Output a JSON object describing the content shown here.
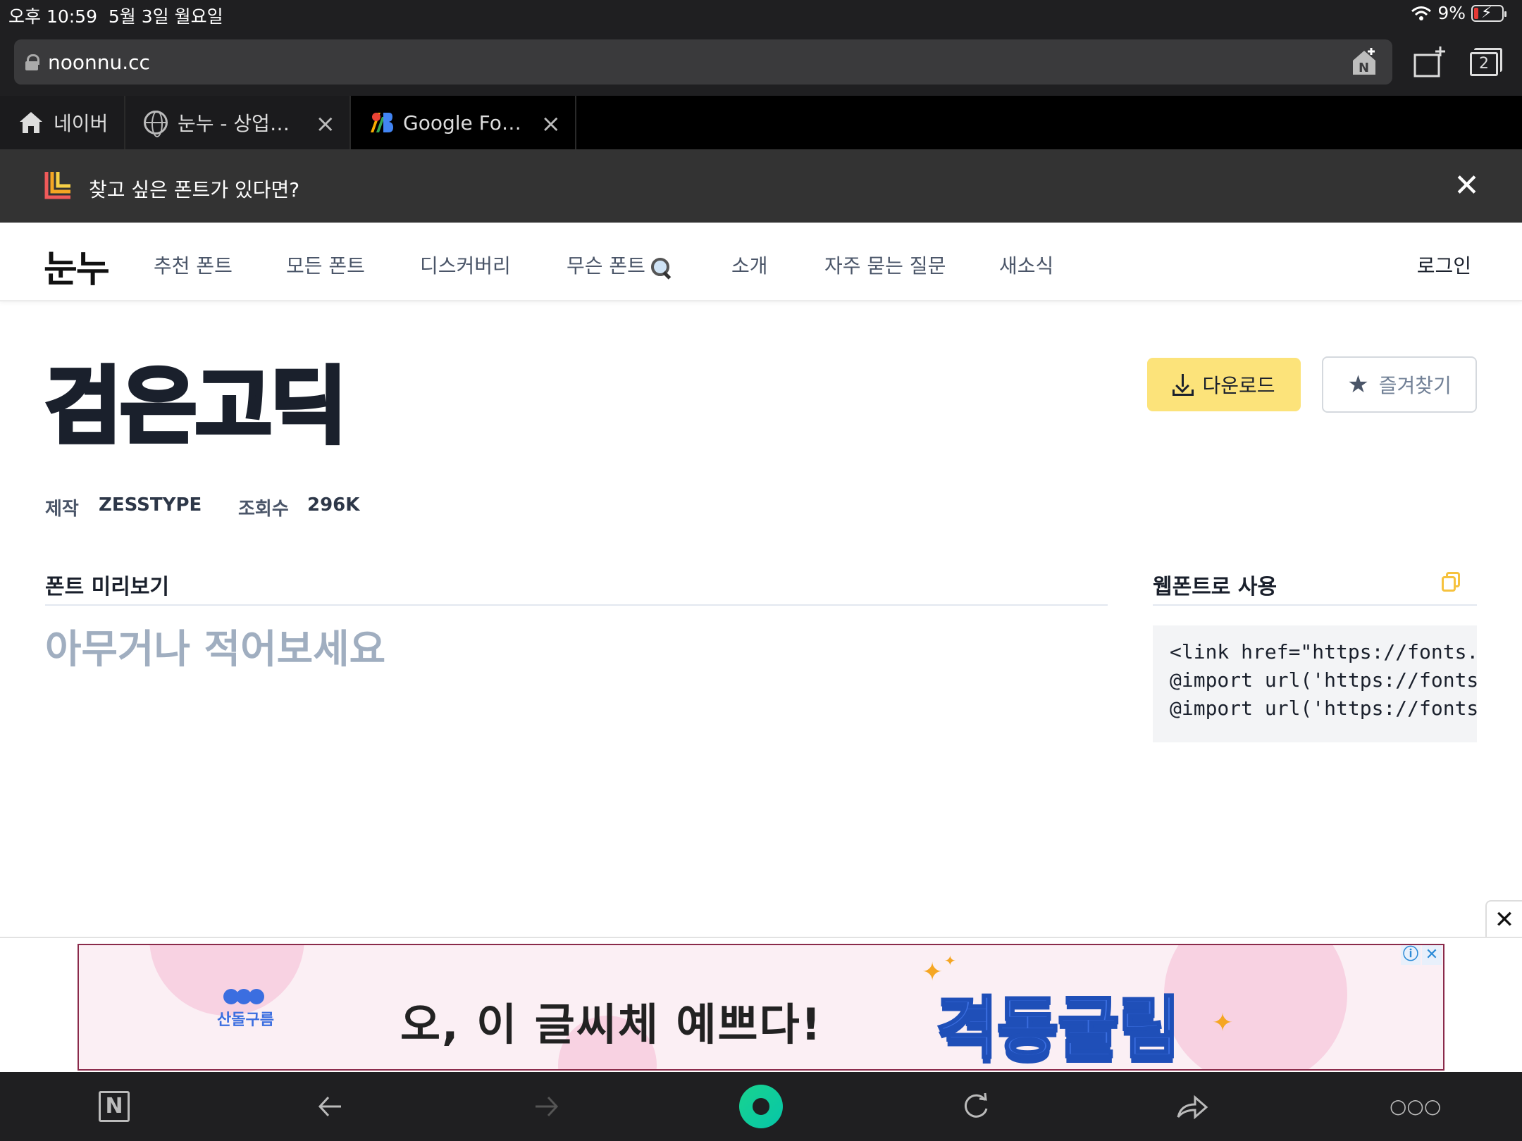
{
  "status_bar": {
    "time": "오후 10:59",
    "date": "5월 3일 월요일",
    "battery": "9%"
  },
  "browser": {
    "url": "noonnu.cc",
    "tab_count": "2",
    "tabs": [
      {
        "label": "네이버",
        "icon": "home-icon"
      },
      {
        "label": "눈누 - 상업…",
        "icon": "globe-icon"
      },
      {
        "label": "Google Fo…",
        "icon": "google-fonts-icon"
      }
    ]
  },
  "notice": {
    "text": "찾고 싶은 폰트가 있다면?"
  },
  "site": {
    "brand": "눈누",
    "nav": [
      "추천 폰트",
      "모든 폰트",
      "디스커버리",
      "무슨 폰트",
      "소개",
      "자주 묻는 질문",
      "새소식"
    ],
    "login": "로그인"
  },
  "font": {
    "name": "검은고딕",
    "maker_label": "제작",
    "maker": "ZESSTYPE",
    "views_label": "조회수",
    "views": "296K",
    "download_label": "다운로드",
    "favorite_label": "즐겨찾기"
  },
  "preview": {
    "section_title": "폰트 미리보기",
    "placeholder": "아무거나 적어보세요"
  },
  "webfont": {
    "section_title": "웹폰트로 사용",
    "code_lines": [
      "<link href=\"https://fonts.",
      "@import url('https://fonts",
      "@import url('https://fonts"
    ]
  },
  "ad": {
    "logo_text": "산돌구름",
    "headline": "오, 이 글씨체 예쁘다!",
    "brand": "격동굴림",
    "close": "✕"
  },
  "colors": {
    "accent_yellow": "#fce37a",
    "ad_blue": "#3b6ee0",
    "toolbar": "#1f1f21"
  }
}
